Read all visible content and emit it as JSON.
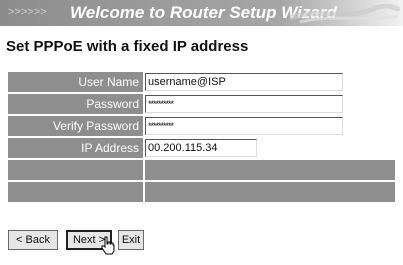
{
  "header": {
    "arrows": ">>>>>>",
    "title": "Welcome to Router Setup Wizard"
  },
  "page": {
    "subtitle": "Set PPPoE with a fixed IP address"
  },
  "form": {
    "user_name": {
      "label": "User Name",
      "value": "username@ISP"
    },
    "password": {
      "label": "Password",
      "value": "**********"
    },
    "verify_password": {
      "label": "Verify Password",
      "value": "**********"
    },
    "ip_address": {
      "label": "IP Address",
      "value": "00.200.115.34"
    }
  },
  "buttons": {
    "back": "< Back",
    "next": "Next >",
    "exit": "Exit"
  },
  "cursor": {
    "icon": "hand-pointer-icon"
  },
  "colors": {
    "label_bg": "#8e8e8e",
    "banner_dark": "#8c8c8c",
    "banner_light": "#f2f2f2"
  }
}
